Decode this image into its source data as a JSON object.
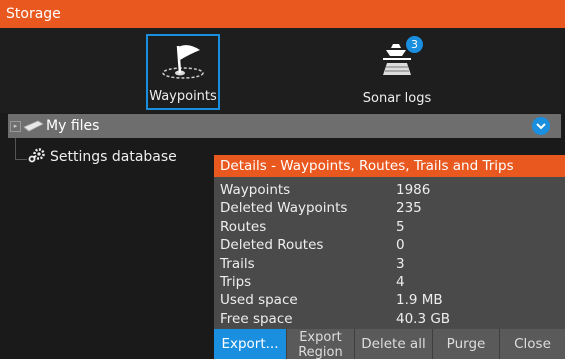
{
  "window": {
    "title": "Storage"
  },
  "tiles": [
    {
      "label": "Waypoints",
      "selected": true,
      "icon": "flag-waypoint-icon"
    },
    {
      "label": "Sonar logs",
      "badge": "3",
      "icon": "boat-sonar-icon"
    }
  ],
  "tree": {
    "root_label": "My files",
    "child_label": "Settings database"
  },
  "details": {
    "title": "Details - Waypoints, Routes, Trails and Trips",
    "rows": [
      {
        "key": "Waypoints",
        "value": "1986"
      },
      {
        "key": "Deleted Waypoints",
        "value": "235"
      },
      {
        "key": "Routes",
        "value": "5"
      },
      {
        "key": "Deleted Routes",
        "value": "0"
      },
      {
        "key": "Trails",
        "value": "3"
      },
      {
        "key": "Trips",
        "value": "4"
      },
      {
        "key": "Used space",
        "value": "1.9 MB"
      },
      {
        "key": "Free space",
        "value": "40.3 GB"
      }
    ],
    "buttons": {
      "export": "Export...",
      "export_region_1": "Export",
      "export_region_2": "Region",
      "delete_all": "Delete all",
      "purge": "Purge",
      "close": "Close"
    }
  },
  "colors": {
    "accent": "#e8581f",
    "selection": "#1a8fe0"
  }
}
